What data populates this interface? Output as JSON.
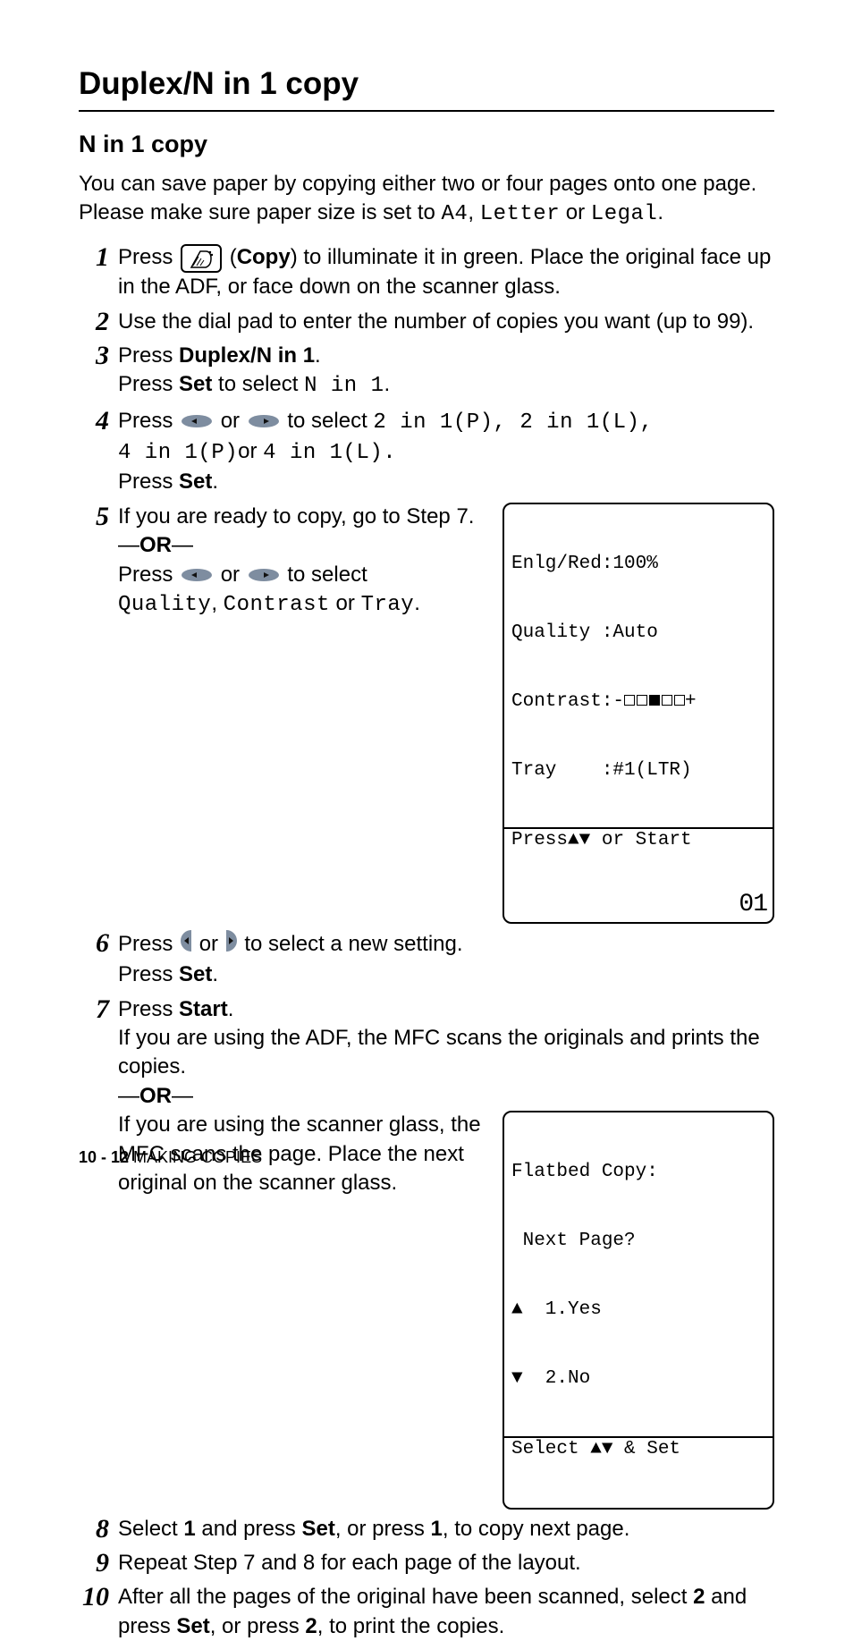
{
  "heading": "Duplex/N in 1 copy",
  "subheading": "N in 1 copy",
  "intro_parts": {
    "p1": "You can save paper by copying either two or four pages onto one page. Please make sure paper size is set to ",
    "m1": "A4",
    "c1": ", ",
    "m2": "Letter",
    "c2": " or ",
    "m3": "Legal",
    "c3": "."
  },
  "steps": {
    "s1": {
      "num": "1",
      "a": "Press ",
      "b": "Copy",
      "c": ") to illuminate it in green. Place the original face up in the ADF, or face down on the scanner glass."
    },
    "s2": {
      "num": "2",
      "a": "Use the dial pad to enter the number of copies you want (up to 99)."
    },
    "s3": {
      "num": "3",
      "a": "Press ",
      "b": "Duplex/N in 1",
      "c": ".",
      "d": "Press ",
      "e": "Set",
      "f": " to select ",
      "g": "N in 1",
      "h": "."
    },
    "s4": {
      "num": "4",
      "a": "Press ",
      "b": " or ",
      "c": " to select ",
      "m1": "2 in 1(P)",
      "cm": ", ",
      "m2": "2 in 1(L)",
      "cm2": ",",
      "m3": "4 in 1(P)",
      "or": "or ",
      "m4": "4 in 1(L)",
      "dot": ".",
      "d": "Press ",
      "e": "Set",
      "f": "."
    },
    "s5": {
      "num": "5",
      "a": "If you are ready to copy, go to Step 7.",
      "or": "—OR—",
      "b": "Press ",
      "c": " or ",
      "d": " to select",
      "m1": "Quality",
      "cm": ", ",
      "m2": "Contrast",
      "or2": " or ",
      "m3": "Tray",
      "dot": "."
    },
    "s6": {
      "num": "6",
      "a": "Press ",
      "b": " or ",
      "c": " to select a new setting.",
      "d": "Press ",
      "e": "Set",
      "f": "."
    },
    "s7": {
      "num": "7",
      "a": "Press ",
      "b": "Start",
      "c": ".",
      "d": "If you are using the ADF, the MFC scans the originals and prints the copies.",
      "or": "—OR—",
      "e": "If you are using the scanner glass, the MFC scans the page. Place the next original on the scanner glass."
    },
    "s8": {
      "num": "8",
      "a": "Select ",
      "b": "1",
      "c": " and press ",
      "d": "Set",
      "e": ", or press ",
      "f": "1",
      "g": ", to copy next page."
    },
    "s9": {
      "num": "9",
      "a": "Repeat Step 7 and 8 for each page of the layout."
    },
    "s10": {
      "num": "10",
      "a": "After all the pages of the original have been scanned, select ",
      "b": "2",
      "c": " and press ",
      "d": "Set",
      "e": ", or press ",
      "f": "2",
      "g": ", to print the copies."
    }
  },
  "lcd1": {
    "l1": "Enlg/Red:100%",
    "l2": "Quality :Auto",
    "l3a": "Contrast:-",
    "l3b": "+",
    "l4": "Tray    :#1(LTR)",
    "l5a": "Press",
    "l5b": "▲▼",
    "l5c": " or Start",
    "num": "01"
  },
  "lcd2": {
    "l1": "Flatbed Copy:",
    "l2": " Next Page?",
    "l3": "▲  1.Yes",
    "l4": "▼  2.No",
    "l5": "Select ▲▼ & Set"
  },
  "footer": {
    "page": "10 - 12",
    "section": "   MAKING COPIES"
  },
  "icons": {
    "copy": "copy-icon",
    "arrow_left": "nav-left-icon",
    "arrow_right": "nav-right-icon",
    "half_left": "half-left-icon",
    "half_right": "half-right-icon"
  }
}
